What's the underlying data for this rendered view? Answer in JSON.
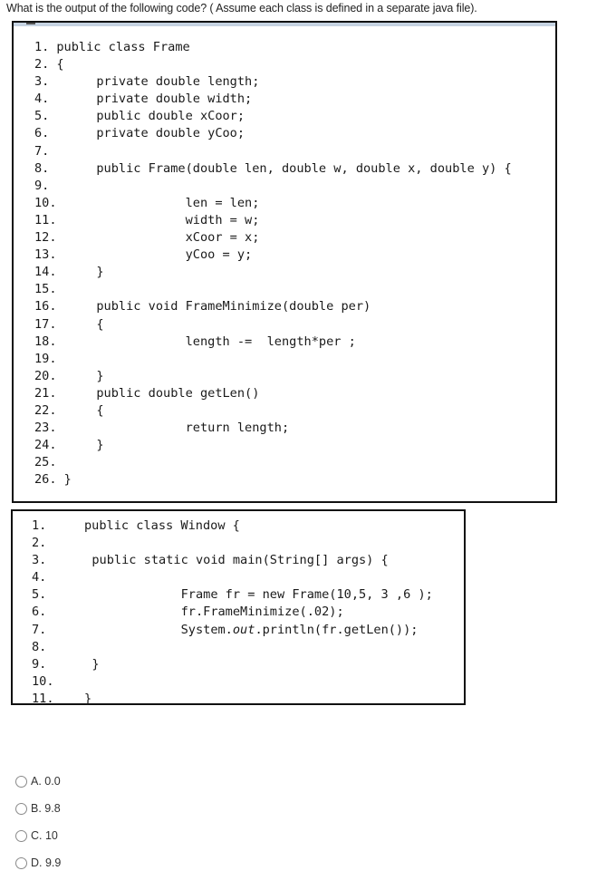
{
  "question": {
    "text": "What is the output of the following code? ( Assume each class is defined in a separate java file)."
  },
  "code_blocks": [
    {
      "name": "Frame",
      "lines": [
        {
          "num": "1.",
          "code": "public class Frame",
          "inline": true
        },
        {
          "num": "2.",
          "code": "{",
          "inline": true
        },
        {
          "num": "3.",
          "code": "      private double length;"
        },
        {
          "num": "4.",
          "code": "      private double width;"
        },
        {
          "num": "5.",
          "code": "      public double xCoor;"
        },
        {
          "num": "6.",
          "code": "      private double yCoo;"
        },
        {
          "num": "7.",
          "code": ""
        },
        {
          "num": "8.",
          "code": "      public Frame(double len, double w, double x, double y) {"
        },
        {
          "num": "9.",
          "code": ""
        },
        {
          "num": "10.",
          "code": "            len = len;"
        },
        {
          "num": "11.",
          "code": "            width = w;"
        },
        {
          "num": "12.",
          "code": "            xCoor = x;"
        },
        {
          "num": "13.",
          "code": "            yCoo = y;"
        },
        {
          "num": "14.",
          "code": "      }"
        },
        {
          "num": "15.",
          "code": ""
        },
        {
          "num": "16.",
          "code": "      public void FrameMinimize(double per)"
        },
        {
          "num": "17.",
          "code": "      {"
        },
        {
          "num": "18.",
          "code": "            length -=  length*per ;"
        },
        {
          "num": "19.",
          "code": ""
        },
        {
          "num": "20.",
          "code": "      }"
        },
        {
          "num": "21.",
          "code": "      public double getLen()"
        },
        {
          "num": "22.",
          "code": "      {"
        },
        {
          "num": "23.",
          "code": "            return length;"
        },
        {
          "num": "24.",
          "code": "      }"
        },
        {
          "num": "25.",
          "code": ""
        },
        {
          "num": "26.",
          "code": "}",
          "inline": true
        }
      ]
    },
    {
      "name": "Window",
      "lines": [
        {
          "num": "1.",
          "code": "public class Window {",
          "inline": true
        },
        {
          "num": "2.",
          "code": ""
        },
        {
          "num": "3.",
          "code": "      public static void main(String[] args) {"
        },
        {
          "num": "4.",
          "code": ""
        },
        {
          "num": "5.",
          "code": "            Frame fr = new Frame(10,5, 3 ,6 );"
        },
        {
          "num": "6.",
          "code": "            fr.FrameMinimize(.02);"
        },
        {
          "num": "7.",
          "code": "            System.out.println(fr.getLen());"
        },
        {
          "num": "8.",
          "code": ""
        },
        {
          "num": "9.",
          "code": "      }"
        },
        {
          "num": "10.",
          "code": ""
        },
        {
          "num": "11.",
          "code": "}",
          "inline": true
        }
      ]
    }
  ],
  "options": [
    {
      "label": "A. 0.0",
      "selected": false
    },
    {
      "label": "B. 9.8",
      "selected": false
    },
    {
      "label": "C. 10",
      "selected": false
    },
    {
      "label": "D. 9.9",
      "selected": false
    }
  ]
}
